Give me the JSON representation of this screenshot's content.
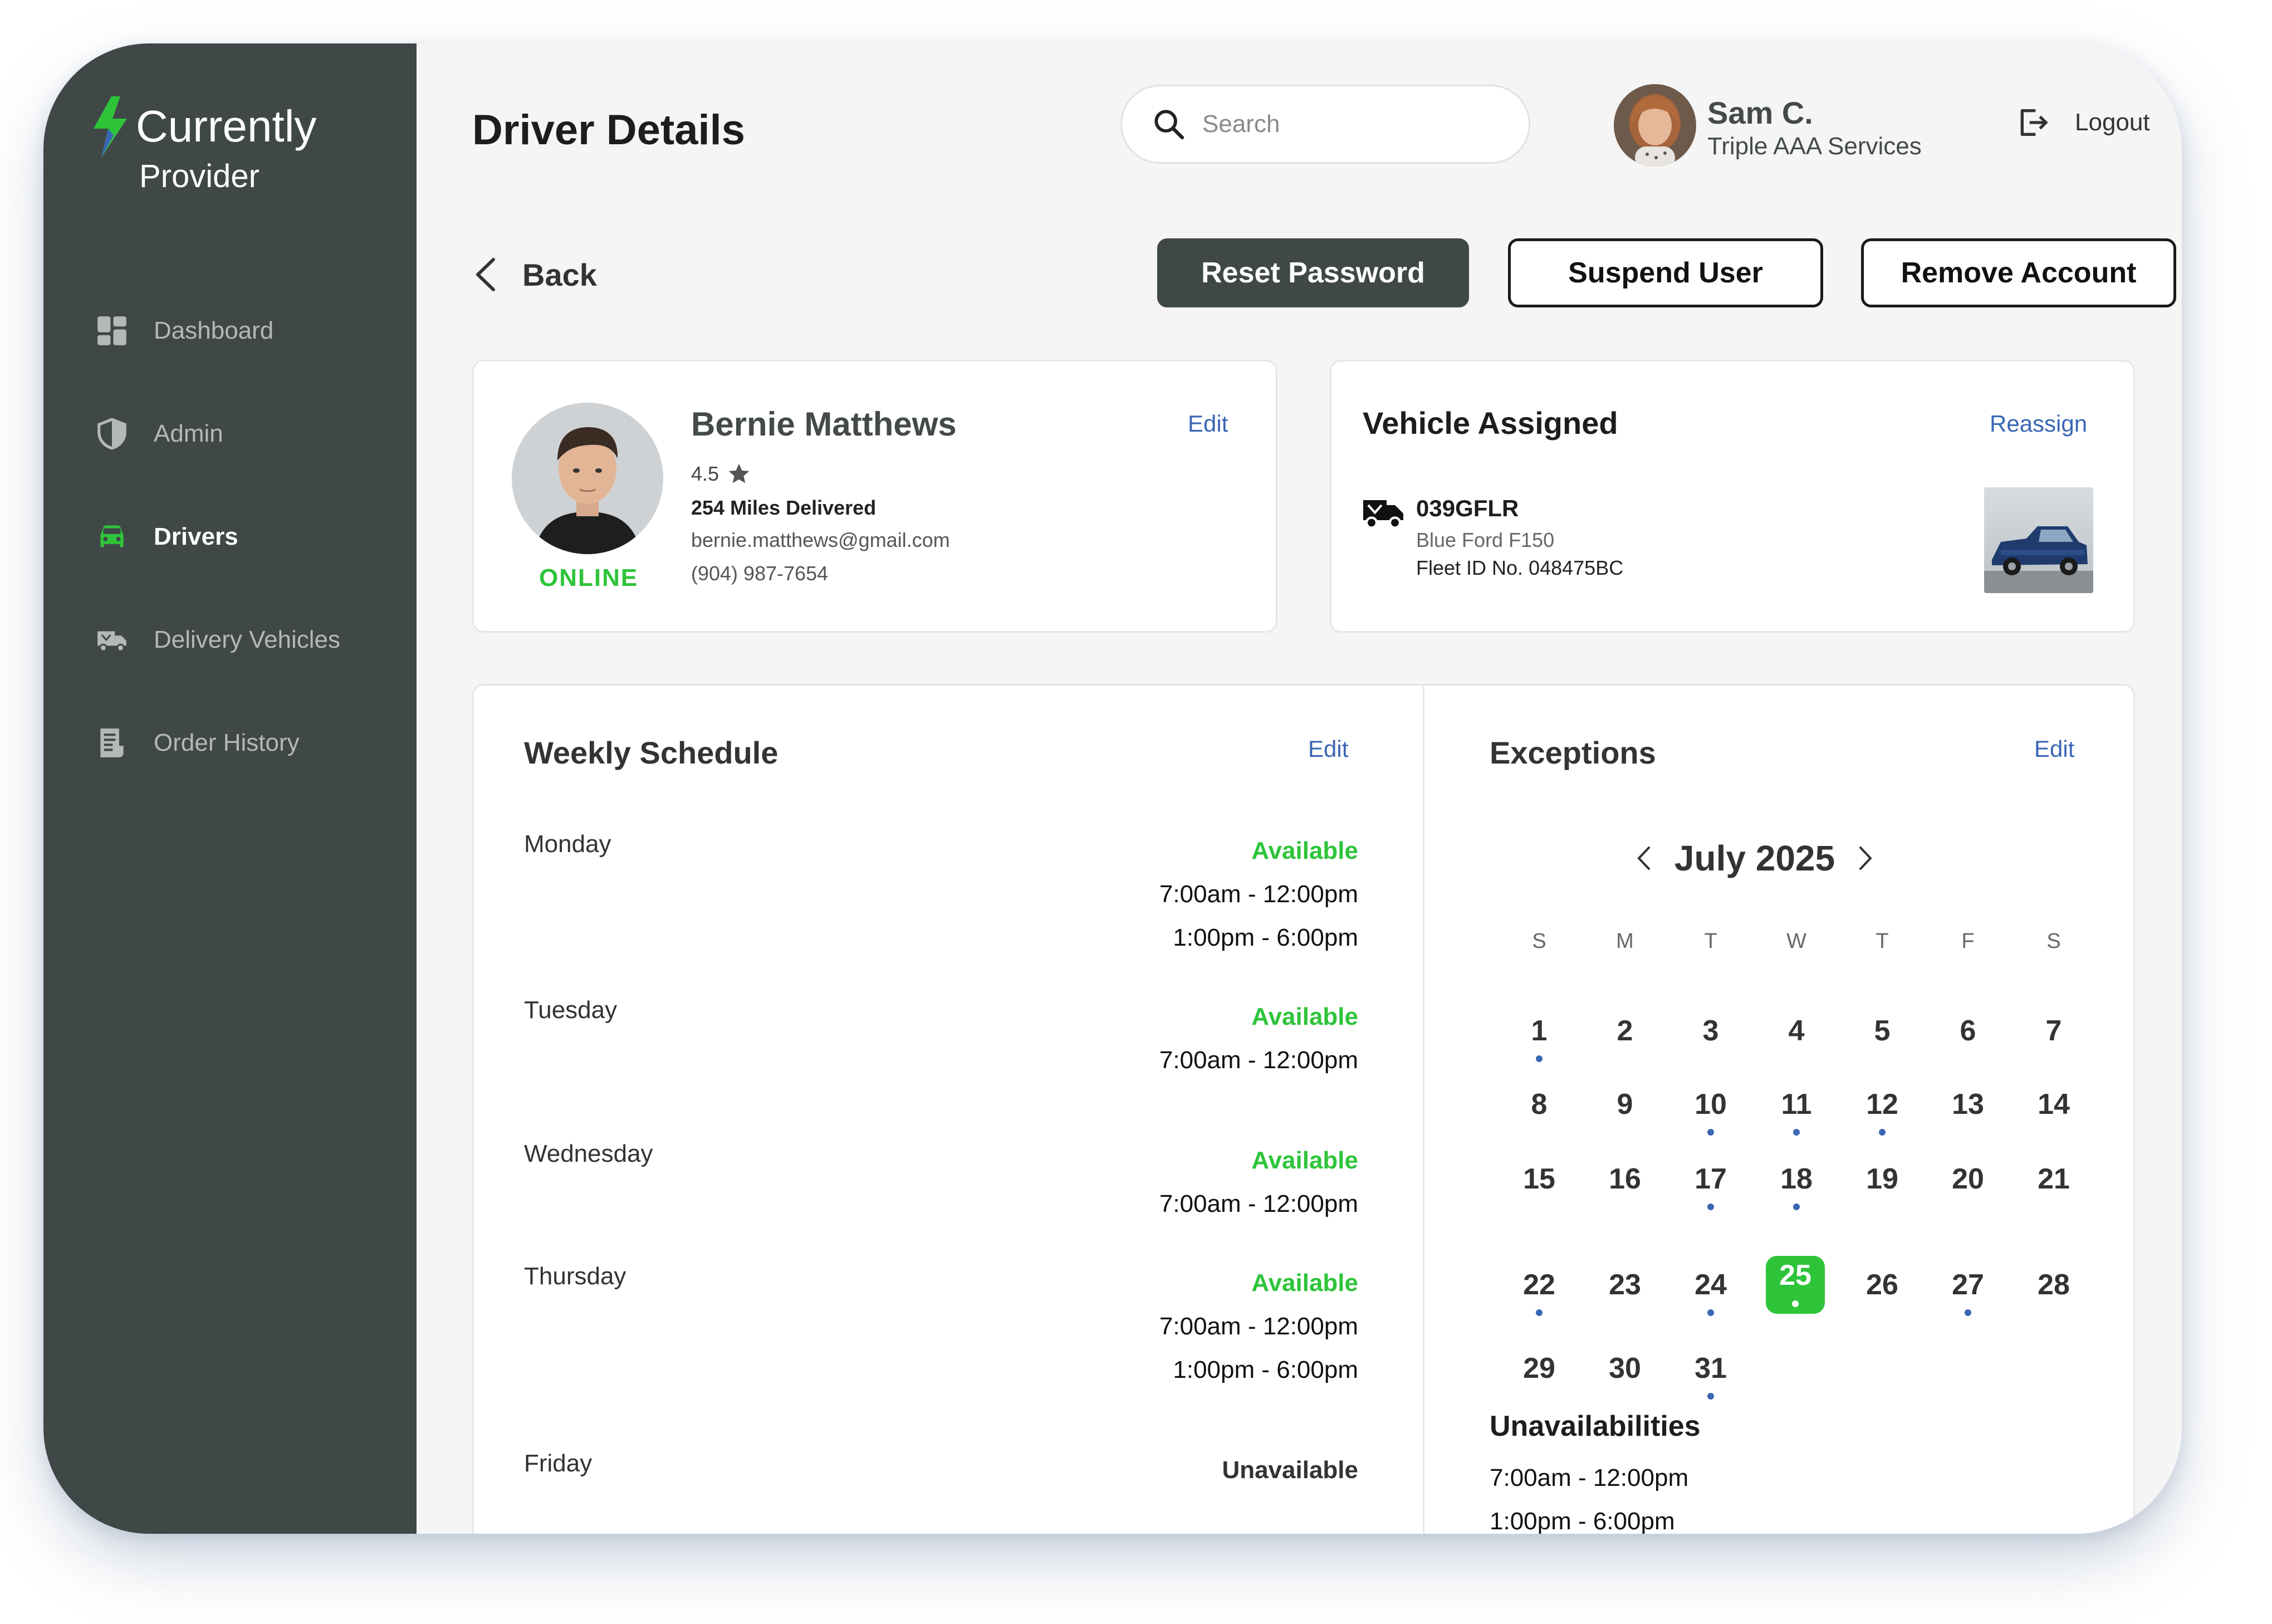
{
  "brand": {
    "name": "Currently",
    "subtitle": "Provider",
    "accent": "#2ec43a"
  },
  "sidebar": {
    "items": [
      {
        "label": "Dashboard",
        "icon": "dashboard-icon",
        "active": false
      },
      {
        "label": "Admin",
        "icon": "shield-icon",
        "active": false
      },
      {
        "label": "Drivers",
        "icon": "car-icon",
        "active": true
      },
      {
        "label": "Delivery Vehicles",
        "icon": "delivery-truck-icon",
        "active": false
      },
      {
        "label": "Order History",
        "icon": "receipt-icon",
        "active": false
      }
    ]
  },
  "header": {
    "title": "Driver Details",
    "search_placeholder": "Search",
    "user": {
      "name": "Sam C.",
      "org": "Triple AAA Services"
    },
    "logout_label": "Logout"
  },
  "actions": {
    "back_label": "Back",
    "reset_password": "Reset Password",
    "suspend_user": "Suspend User",
    "remove_account": "Remove Account"
  },
  "driver": {
    "name": "Bernie Matthews",
    "rating": "4.5",
    "miles": "254 Miles Delivered",
    "email": "bernie.matthews@gmail.com",
    "phone": "(904) 987-7654",
    "status": "ONLINE",
    "edit_label": "Edit"
  },
  "vehicle": {
    "title": "Vehicle Assigned",
    "reassign_label": "Reassign",
    "plate": "039GFLR",
    "model": "Blue Ford F150",
    "fleet": "Fleet ID No. 048475BC"
  },
  "schedule": {
    "title": "Weekly Schedule",
    "edit_label": "Edit",
    "days": [
      {
        "day": "Monday",
        "status": "Available",
        "slots": [
          "7:00am - 12:00pm",
          "1:00pm - 6:00pm"
        ]
      },
      {
        "day": "Tuesday",
        "status": "Available",
        "slots": [
          "7:00am - 12:00pm"
        ]
      },
      {
        "day": "Wednesday",
        "status": "Available",
        "slots": [
          "7:00am - 12:00pm"
        ]
      },
      {
        "day": "Thursday",
        "status": "Available",
        "slots": [
          "7:00am - 12:00pm",
          "1:00pm - 6:00pm"
        ]
      },
      {
        "day": "Friday",
        "status": "Unavailable",
        "slots": []
      }
    ]
  },
  "exceptions": {
    "title": "Exceptions",
    "edit_label": "Edit",
    "month": "July 2025",
    "weekdays": [
      "S",
      "M",
      "T",
      "W",
      "T",
      "F",
      "S"
    ],
    "days_in_month": 31,
    "start_weekday": 0,
    "selected_day": 25,
    "marked_days": [
      1,
      10,
      11,
      12,
      17,
      18,
      22,
      24,
      25,
      27,
      31
    ],
    "unavailabilities_title": "Unavailabilities",
    "unavailabilities": [
      "7:00am - 12:00pm",
      "1:00pm - 6:00pm"
    ]
  }
}
